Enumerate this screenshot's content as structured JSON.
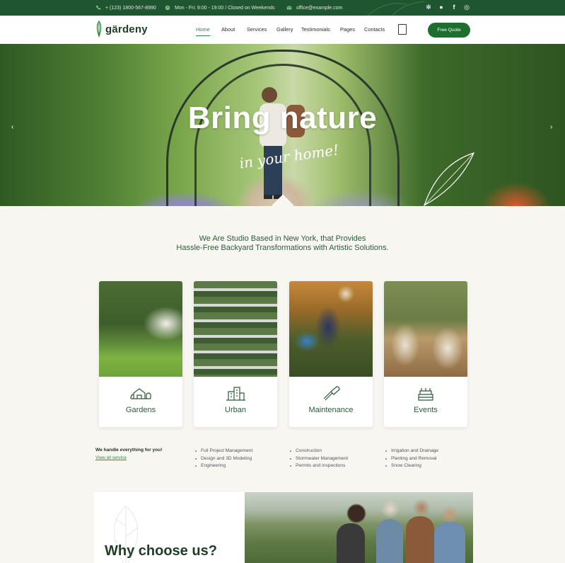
{
  "topbar": {
    "phone": "+ (123) 1800-567-8990",
    "hours": "Mon - Fri: 9:00 - 19:00 / Closed on Weekends",
    "email": "office@example.com",
    "social_icons": [
      "tripadvisor-icon",
      "pinterest-icon",
      "facebook-icon",
      "instagram-icon"
    ]
  },
  "nav": {
    "logo": "gärdeny",
    "items": [
      "Home",
      "About",
      "Services",
      "Gallery",
      "Testimonials",
      "Pages",
      "Contacts"
    ],
    "active": "Home",
    "cta": "Free Quote"
  },
  "hero": {
    "title": "Bring nature",
    "script": "in your home!"
  },
  "intro": {
    "line1": "We Are Studio Based in New York, that Provides",
    "line2": "Hassle-Free Backyard Transformations with Artistic Solutions."
  },
  "services": [
    {
      "title": "Gardens",
      "icon": "house-garden-icon"
    },
    {
      "title": "Urban",
      "icon": "buildings-icon"
    },
    {
      "title": "Maintenance",
      "icon": "trowel-icon"
    },
    {
      "title": "Events",
      "icon": "cake-icon"
    }
  ],
  "handle": {
    "title": "We handle everything for you!",
    "link": "View all service",
    "columns": [
      [
        "Full Project Management",
        "Design and 3D Modeling",
        "Engineering"
      ],
      [
        "Construction",
        "Stormwater Management",
        "Permits and Inspections"
      ],
      [
        "Irrigation and Drainage",
        "Planting and Removal",
        "Snow Clearing"
      ]
    ]
  },
  "why": {
    "title": "Why choose us?"
  },
  "colors": {
    "brand_dark": "#1f5530",
    "brand_green": "#1f6e30",
    "accent": "#2c8b3b",
    "background": "#f8f6f1"
  }
}
